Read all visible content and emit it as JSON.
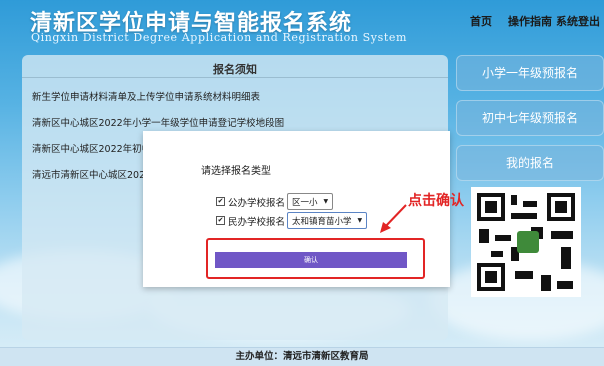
{
  "header": {
    "title": "清新区学位申请与智能报名系统",
    "subtitle": "Qingxin District Degree Application and Registration System",
    "nav": [
      "首页",
      "操作指南",
      "系统登出"
    ]
  },
  "notice": {
    "title": "报名须知",
    "items": [
      "新生学位申请材料清单及上传学位申请系统材料明细表",
      "清新区中心城区2022年小学一年级学位申请登记学校地段图",
      "清新区中心城区2022年初中",
      "清远市清新区中心城区202"
    ]
  },
  "side_buttons": [
    "小学一年级预报名",
    "初中七年级预报名",
    "我的报名"
  ],
  "modal": {
    "heading": "请选择报名类型",
    "options": [
      {
        "label": "公办学校报名",
        "checked": true,
        "select_value": "区一小"
      },
      {
        "label": "民办学校报名",
        "checked": true,
        "select_value": "太和镇育苗小学"
      }
    ],
    "confirm_label": "确认"
  },
  "annotation": {
    "text": "点击确认",
    "color": "#e22525"
  },
  "footer": {
    "text": "主办单位：清远市清新区教育局"
  }
}
